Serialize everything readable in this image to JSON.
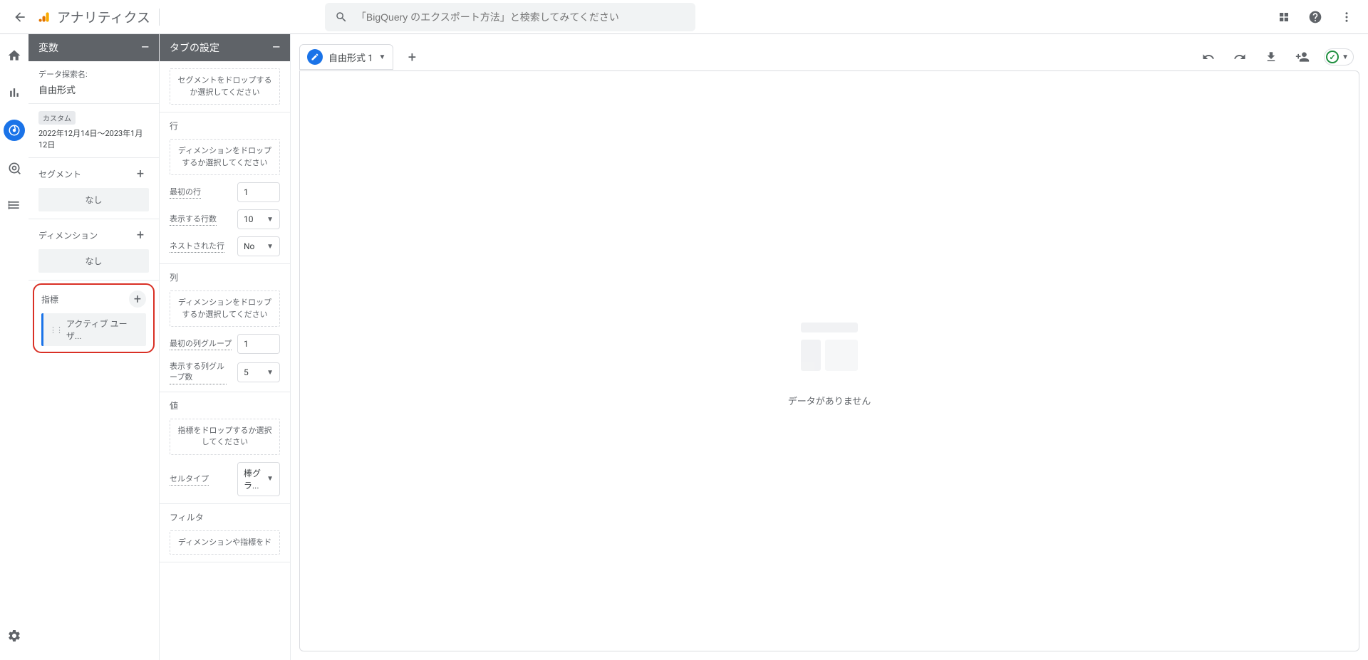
{
  "header": {
    "app_title": "アナリティクス",
    "search_placeholder": "「BigQuery のエクスポート方法」と検索してみてください"
  },
  "variables_panel": {
    "title": "変数",
    "name_label": "データ探索名:",
    "name_value": "自由形式",
    "date_badge": "カスタム",
    "date_range": "2022年12月14日～2023年1月12日",
    "segments": {
      "title": "セグメント",
      "none": "なし"
    },
    "dimensions": {
      "title": "ディメンション",
      "none": "なし"
    },
    "metrics": {
      "title": "指標",
      "item": "アクティブ ユーザ..."
    }
  },
  "settings_panel": {
    "title": "タブの設定",
    "segment_drop": "セグメントをドロップするか選択してください",
    "rows": {
      "title": "行",
      "drop": "ディメンションをドロップするか選択してください",
      "first_row_label": "最初の行",
      "first_row_value": "1",
      "show_rows_label": "表示する行数",
      "show_rows_value": "10",
      "nested_label": "ネストされた行",
      "nested_value": "No"
    },
    "columns": {
      "title": "列",
      "drop": "ディメンションをドロップするか選択してください",
      "first_col_label": "最初の列グループ",
      "first_col_value": "1",
      "show_cols_label": "表示する列グループ数",
      "show_cols_value": "5"
    },
    "values": {
      "title": "値",
      "drop": "指標をドロップするか選択してください",
      "cell_type_label": "セルタイプ",
      "cell_type_value": "棒グラ..."
    },
    "filters": {
      "title": "フィルタ",
      "drop": "ディメンションや指標をド"
    }
  },
  "canvas": {
    "tab_name": "自由形式 1",
    "empty_text": "データがありません"
  }
}
